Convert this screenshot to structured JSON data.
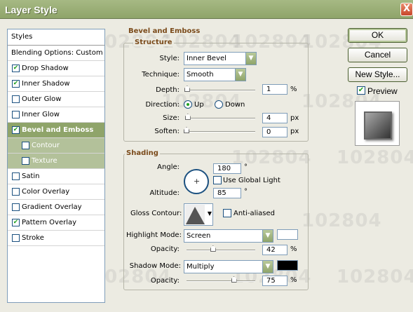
{
  "window": {
    "title": "Layer Style",
    "close_label": "X"
  },
  "watermark": "102804",
  "styles_list": {
    "header": "Styles",
    "items": [
      {
        "label": "Blending Options: Custom",
        "checkbox": false,
        "checked": false
      },
      {
        "label": "Drop Shadow",
        "checkbox": true,
        "checked": true
      },
      {
        "label": "Inner Shadow",
        "checkbox": true,
        "checked": true
      },
      {
        "label": "Outer Glow",
        "checkbox": true,
        "checked": false
      },
      {
        "label": "Inner Glow",
        "checkbox": true,
        "checked": false
      },
      {
        "label": "Bevel and Emboss",
        "checkbox": true,
        "checked": true,
        "selected": true
      },
      {
        "label": "Contour",
        "checkbox": true,
        "checked": false,
        "sub": true
      },
      {
        "label": "Texture",
        "checkbox": true,
        "checked": false,
        "sub": true
      },
      {
        "label": "Satin",
        "checkbox": true,
        "checked": false
      },
      {
        "label": "Color Overlay",
        "checkbox": true,
        "checked": false
      },
      {
        "label": "Gradient Overlay",
        "checkbox": true,
        "checked": false
      },
      {
        "label": "Pattern Overlay",
        "checkbox": true,
        "checked": true
      },
      {
        "label": "Stroke",
        "checkbox": true,
        "checked": false
      }
    ]
  },
  "bevel": {
    "title": "Bevel and Emboss",
    "structure": {
      "title": "Structure",
      "style_label": "Style:",
      "style_value": "Inner Bevel",
      "technique_label": "Technique:",
      "technique_value": "Smooth",
      "depth_label": "Depth:",
      "depth_value": "1",
      "depth_unit": "%",
      "depth_level": 0.01,
      "direction_label": "Direction:",
      "dir_up": "Up",
      "dir_down": "Down",
      "direction_selected": "Up",
      "size_label": "Size:",
      "size_value": "4",
      "size_unit": "px",
      "size_level": 0.02,
      "soften_label": "Soften:",
      "soften_value": "0",
      "soften_unit": "px",
      "soften_level": 0
    },
    "shading": {
      "title": "Shading",
      "angle_label": "Angle:",
      "angle_value": "180",
      "angle_unit": "°",
      "global_light_label": "Use Global Light",
      "global_light_checked": false,
      "altitude_label": "Altitude:",
      "altitude_value": "85",
      "altitude_unit": "°",
      "gloss_label": "Gloss Contour:",
      "anti_aliased_label": "Anti-aliased",
      "anti_aliased_checked": false,
      "highlight_label": "Highlight Mode:",
      "highlight_value": "Screen",
      "highlight_color": "#ffffff",
      "h_opacity_label": "Opacity:",
      "h_opacity_value": "42",
      "h_opacity_unit": "%",
      "h_opacity_level": 0.42,
      "shadow_label": "Shadow Mode:",
      "shadow_value": "Multiply",
      "shadow_color": "#000000",
      "s_opacity_label": "Opacity:",
      "s_opacity_value": "75",
      "s_opacity_unit": "%",
      "s_opacity_level": 0.75
    }
  },
  "buttons": {
    "ok": "OK",
    "cancel": "Cancel",
    "new_style": "New Style...",
    "preview": "Preview",
    "preview_checked": true
  }
}
